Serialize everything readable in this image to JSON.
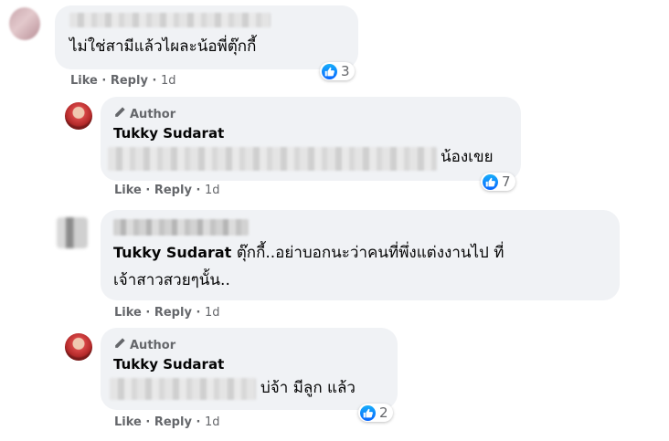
{
  "comments": [
    {
      "text": "ไม่ใช่สามีแล้วไผละน้อพี่ตุ๊กกี้",
      "reaction_count": "3",
      "actions": {
        "like": "Like",
        "reply": "Reply",
        "time": "1d"
      }
    },
    {
      "author_tag": "Author",
      "name": "Tukky Sudarat",
      "text": "น้องเขย",
      "reaction_count": "7",
      "actions": {
        "like": "Like",
        "reply": "Reply",
        "time": "1d"
      }
    },
    {
      "mention": "Tukky Sudarat",
      "text_line1": "ตุ๊กกี้..อย่าบอกนะว่าคนที่พึ่งแต่งงานไป ที่",
      "text_line2": "เจ้าสาวสวยๆนั้น..",
      "actions": {
        "like": "Like",
        "reply": "Reply",
        "time": "1d"
      }
    },
    {
      "author_tag": "Author",
      "name": "Tukky Sudarat",
      "text": "บ่จ้า มีลูก แล้ว",
      "reaction_count": "2",
      "actions": {
        "like": "Like",
        "reply": "Reply",
        "time": "1d"
      }
    }
  ],
  "icons": {
    "like": "like-icon",
    "author": "pencil-icon"
  },
  "colors": {
    "bubble": "#f0f2f5",
    "secondary_text": "#65676b",
    "like_blue": "#0866ff"
  }
}
